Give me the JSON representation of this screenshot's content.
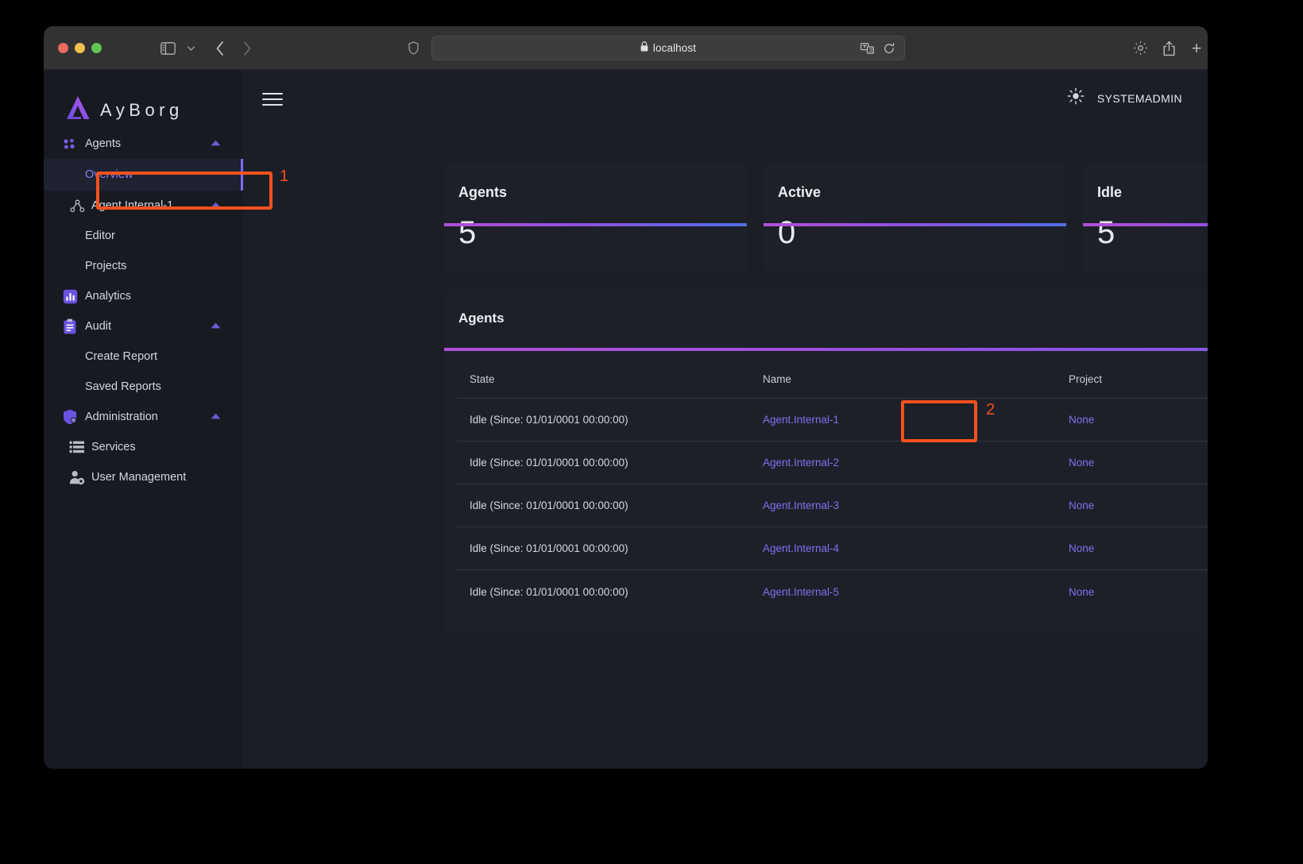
{
  "browser": {
    "url": "localhost",
    "lock_icon": "lock-icon",
    "sidebar_toggle_icon": "sidebar-toggle-icon",
    "caret_icon": "chevron-down-icon",
    "back_icon": "chevron-left-icon",
    "forward_icon": "chevron-right-icon",
    "shield_icon": "shield-privacy-icon",
    "reader_icon": "reader-translate-icon",
    "reload_icon": "reload-icon",
    "gear_icon": "gear-icon",
    "share_icon": "share-icon",
    "new_tab_label": "+",
    "tabs_icon": "tab-overview-icon"
  },
  "app": {
    "brand": "AyBorg",
    "brand_logo_icon": "ayborg-logo-icon",
    "hamburger_icon": "hamburger-menu-icon",
    "theme_toggle_icon": "sun-icon",
    "username": "SYSTEMADMIN"
  },
  "sidebar": {
    "items": [
      {
        "label": "Agents",
        "icon": "agents-icon",
        "type": "group",
        "expanded": true,
        "caret": "▲"
      },
      {
        "label": "Overview",
        "icon": "",
        "type": "sub",
        "active": true
      },
      {
        "label": "Agent.Internal-1",
        "icon": "hub-icon",
        "type": "sub-group",
        "expanded": true,
        "caret": "▲"
      },
      {
        "label": "Editor",
        "icon": "",
        "type": "sub"
      },
      {
        "label": "Projects",
        "icon": "",
        "type": "sub"
      },
      {
        "label": "Analytics",
        "icon": "analytics-icon",
        "type": "group"
      },
      {
        "label": "Audit",
        "icon": "clipboard-icon",
        "type": "group",
        "expanded": true,
        "caret": "▲"
      },
      {
        "label": "Create Report",
        "icon": "",
        "type": "sub"
      },
      {
        "label": "Saved Reports",
        "icon": "",
        "type": "sub"
      },
      {
        "label": "Administration",
        "icon": "shield-user-icon",
        "type": "group",
        "expanded": true,
        "caret": "▲"
      },
      {
        "label": "Services",
        "icon": "services-list-icon",
        "type": "sub-group"
      },
      {
        "label": "User Management",
        "icon": "user-settings-icon",
        "type": "sub-group"
      }
    ]
  },
  "stats": [
    {
      "title": "Agents",
      "value": "5"
    },
    {
      "title": "Active",
      "value": "0"
    },
    {
      "title": "Idle",
      "value": "5"
    }
  ],
  "agents_panel": {
    "title": "Agents",
    "columns": [
      "State",
      "Name",
      "Project"
    ],
    "rows": [
      {
        "state": "Idle (Since: 01/01/0001 00:00:00)",
        "name": "Agent.Internal-1",
        "project": "None"
      },
      {
        "state": "Idle (Since: 01/01/0001 00:00:00)",
        "name": "Agent.Internal-2",
        "project": "None"
      },
      {
        "state": "Idle (Since: 01/01/0001 00:00:00)",
        "name": "Agent.Internal-3",
        "project": "None"
      },
      {
        "state": "Idle (Since: 01/01/0001 00:00:00)",
        "name": "Agent.Internal-4",
        "project": "None"
      },
      {
        "state": "Idle (Since: 01/01/0001 00:00:00)",
        "name": "Agent.Internal-5",
        "project": "None"
      }
    ]
  },
  "annotations": [
    {
      "number": "1"
    },
    {
      "number": "2"
    }
  ],
  "colors": {
    "accent_purple": "#7e72ef",
    "gradient_start": "#b14fd8",
    "gradient_end": "#4f6ee4",
    "annotation": "#f4511e",
    "panel_bg": "#1d2029",
    "sidebar_bg": "#171a21"
  }
}
